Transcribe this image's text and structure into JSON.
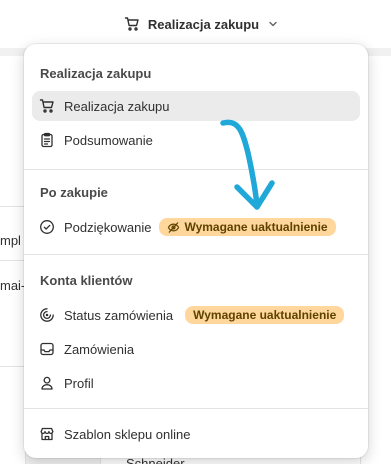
{
  "topbar": {
    "title": "Realizacja zakupu",
    "icon": "cart-icon"
  },
  "background": {
    "left_texts": [
      "mpl",
      "-mai"
    ],
    "bottom_text": "Schneider"
  },
  "menu": {
    "sections": [
      {
        "title": "Realizacja zakupu",
        "items": [
          {
            "label": "Realizacja zakupu",
            "icon": "cart-icon",
            "selected": true
          },
          {
            "label": "Podsumowanie",
            "icon": "clipboard-icon"
          }
        ]
      },
      {
        "title": "Po zakupie",
        "items": [
          {
            "label": "Podziękowanie",
            "icon": "check-circle-icon",
            "badge": "Wymagane uaktualnienie",
            "badge_icon": "eye-off-icon"
          }
        ]
      },
      {
        "title": "Konta klientów",
        "items": [
          {
            "label": "Status zamówienia",
            "icon": "order-status-icon",
            "badge": "Wymagane uaktualnienie"
          },
          {
            "label": "Zamówienia",
            "icon": "inbox-icon"
          },
          {
            "label": "Profil",
            "icon": "person-icon"
          }
        ]
      }
    ],
    "footer_item": {
      "label": "Szablon sklepu online",
      "icon": "store-icon"
    }
  },
  "colors": {
    "badge_bg": "#ffd79d",
    "badge_text": "#5e4200",
    "selected_bg": "#ebebeb",
    "annotation_arrow": "#1fa8d8"
  }
}
